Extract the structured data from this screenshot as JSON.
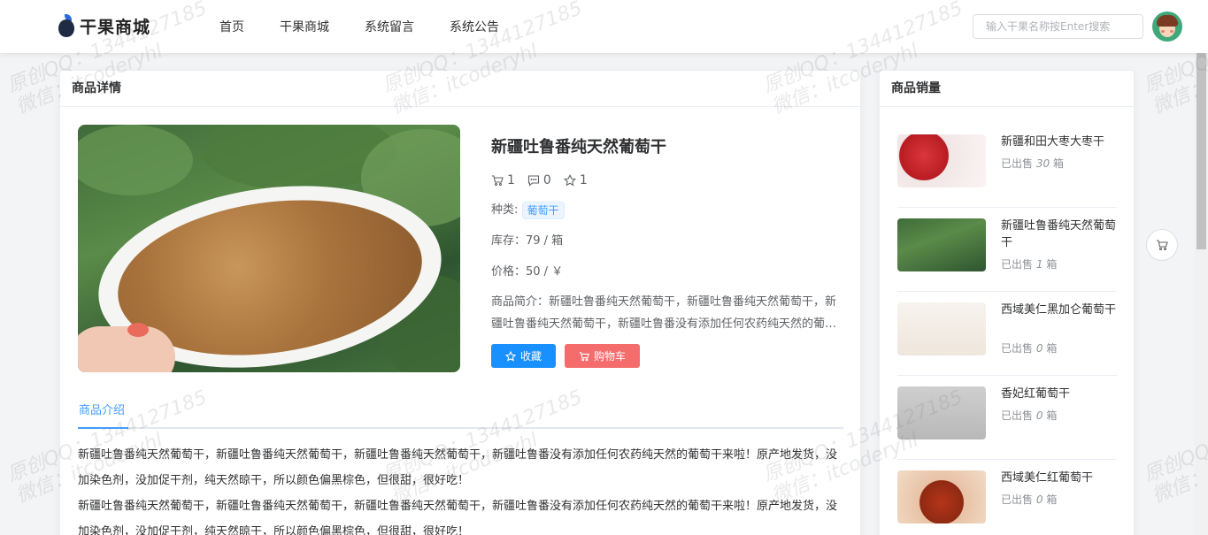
{
  "header": {
    "logo_text": "干果商城",
    "nav": [
      "首页",
      "干果商城",
      "系统留言",
      "系统公告"
    ],
    "search_placeholder": "输入干果名称按Enter搜索"
  },
  "detail": {
    "card_title": "商品详情",
    "product_title": "新疆吐鲁番纯天然葡萄干",
    "stats": {
      "cart": "1",
      "comments": "0",
      "favorites": "1"
    },
    "category_label": "种类:",
    "category_tag": "葡萄干",
    "stock": "库存：79 / 箱",
    "price": "价格：50 / ￥",
    "description": "商品简介：新疆吐鲁番纯天然葡萄干，新疆吐鲁番纯天然葡萄干，新疆吐鲁番纯天然葡萄干，新疆吐鲁番没有添加任何农药纯天然的葡萄干来啦！",
    "fav_button": "收藏",
    "cart_button": "购物车",
    "tab_label": "商品介绍",
    "intro_paragraphs": [
      "新疆吐鲁番纯天然葡萄干，新疆吐鲁番纯天然葡萄干，新疆吐鲁番纯天然葡萄干，新疆吐鲁番没有添加任何农药纯天然的葡萄干来啦！原产地发货，没加染色剂，没加促干剂，纯天然晾干，所以颜色偏黑棕色，但很甜，很好吃！",
      "新疆吐鲁番纯天然葡萄干，新疆吐鲁番纯天然葡萄干，新疆吐鲁番纯天然葡萄干，新疆吐鲁番没有添加任何农药纯天然的葡萄干来啦！原产地发货，没加染色剂，没加促干剂，纯天然晾干，所以颜色偏黑棕色，但很甜，很好吃！"
    ]
  },
  "sales": {
    "card_title": "商品销量",
    "items": [
      {
        "name": "新疆和田大枣大枣干",
        "sold_prefix": "已出售",
        "sold_count": "30",
        "sold_unit": "箱"
      },
      {
        "name": "新疆吐鲁番纯天然葡萄干",
        "sold_prefix": "已出售",
        "sold_count": "1",
        "sold_unit": "箱"
      },
      {
        "name": "西域美仁黑加仑葡萄干",
        "sold_prefix": "已出售",
        "sold_count": "0",
        "sold_unit": "箱"
      },
      {
        "name": "香妃红葡萄干",
        "sold_prefix": "已出售",
        "sold_count": "0",
        "sold_unit": "箱"
      },
      {
        "name": "西域美仁红葡萄干",
        "sold_prefix": "已出售",
        "sold_count": "0",
        "sold_unit": "箱"
      }
    ]
  },
  "watermark": {
    "line1": "原创QQ：1344127185",
    "line2": "微信：itcoderyhl"
  },
  "colors": {
    "primary": "#1890ff",
    "danger": "#f56c6c",
    "tag_text": "#409eff"
  }
}
